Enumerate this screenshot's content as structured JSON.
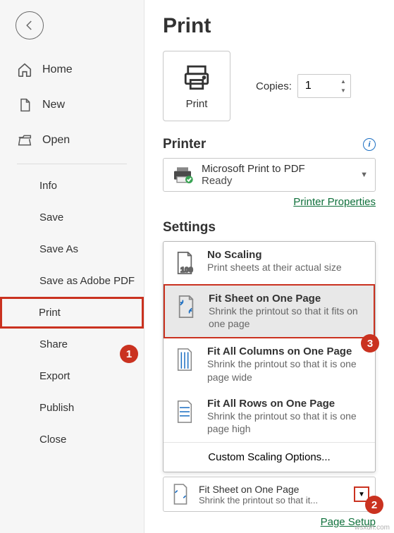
{
  "sidebar": {
    "home": "Home",
    "new": "New",
    "open": "Open",
    "info": "Info",
    "save": "Save",
    "saveAs": "Save As",
    "saveAdobe": "Save as Adobe PDF",
    "print": "Print",
    "share": "Share",
    "export": "Export",
    "publish": "Publish",
    "close": "Close"
  },
  "page": {
    "title": "Print"
  },
  "printBtn": {
    "label": "Print"
  },
  "copies": {
    "label": "Copies:",
    "value": "1"
  },
  "printerSection": {
    "title": "Printer"
  },
  "printer": {
    "name": "Microsoft Print to PDF",
    "status": "Ready"
  },
  "printerProps": "Printer Properties",
  "settingsSection": {
    "title": "Settings"
  },
  "scaling": {
    "none": {
      "title": "No Scaling",
      "desc": "Print sheets at their actual size"
    },
    "fitSheet": {
      "title": "Fit Sheet on One Page",
      "desc": "Shrink the printout so that it fits on one page"
    },
    "fitCols": {
      "title": "Fit All Columns on One Page",
      "desc": "Shrink the printout so that it is one page wide"
    },
    "fitRows": {
      "title": "Fit All Rows on One Page",
      "desc": "Shrink the printout so that it is one page high"
    },
    "custom": "Custom Scaling Options..."
  },
  "summary": {
    "title": "Fit Sheet on One Page",
    "desc": "Shrink the printout so that it..."
  },
  "pageSetup": "Page Setup",
  "badges": {
    "b1": "1",
    "b2": "2",
    "b3": "3"
  },
  "watermark": "wsxdn.com"
}
